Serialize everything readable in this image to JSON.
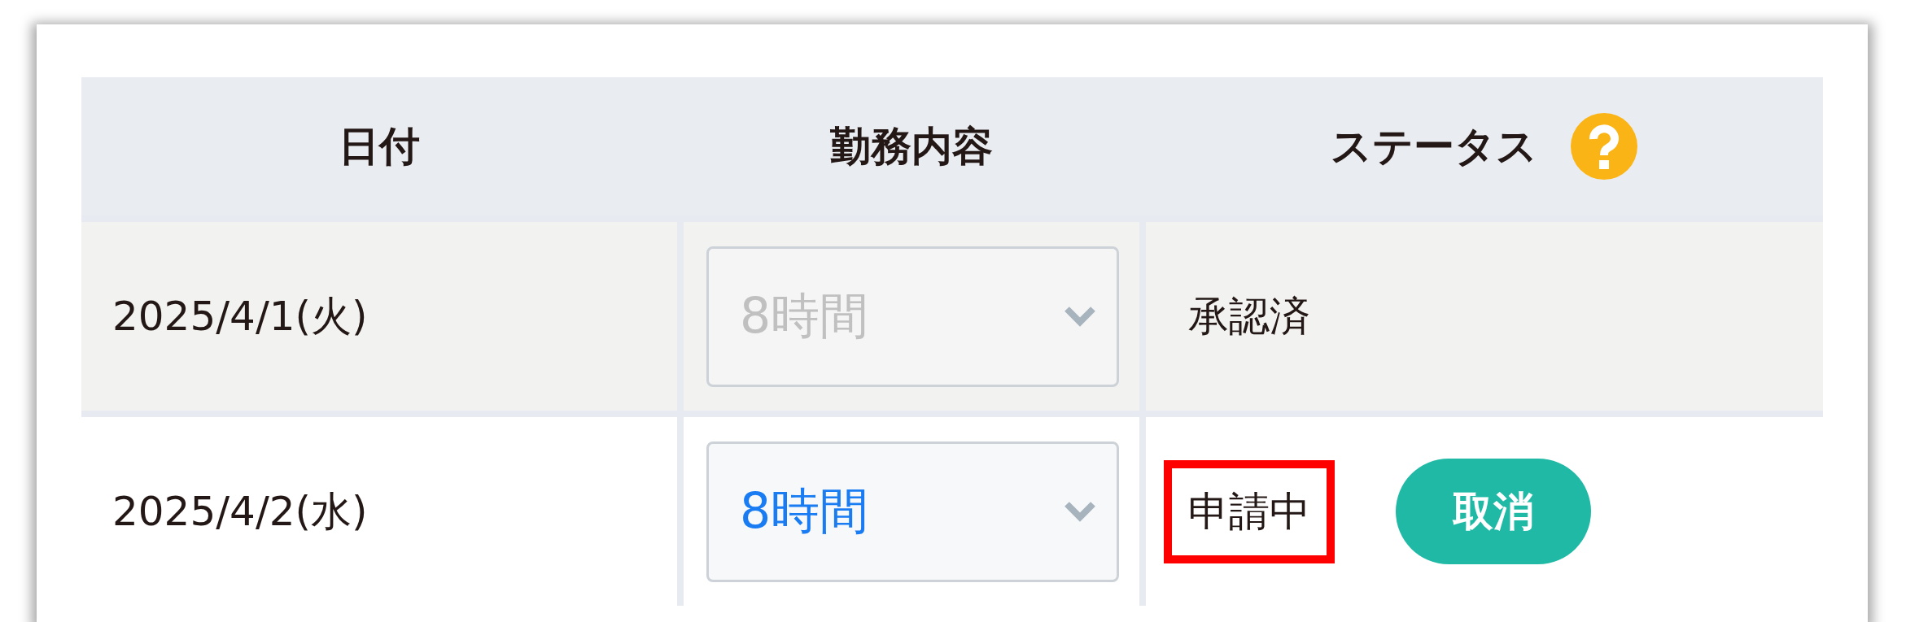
{
  "table": {
    "columns": [
      {
        "label": "日付"
      },
      {
        "label": "勤務内容"
      },
      {
        "label": "ステータス",
        "help": true
      }
    ],
    "rows": [
      {
        "date": "2025/4/1(火)",
        "work": "8時間",
        "disabled": true,
        "status": "承認済",
        "highlighted": false
      },
      {
        "date": "2025/4/2(水)",
        "work": "8時間",
        "disabled": false,
        "status": "申請中",
        "highlighted": true,
        "action": "取消"
      }
    ]
  }
}
